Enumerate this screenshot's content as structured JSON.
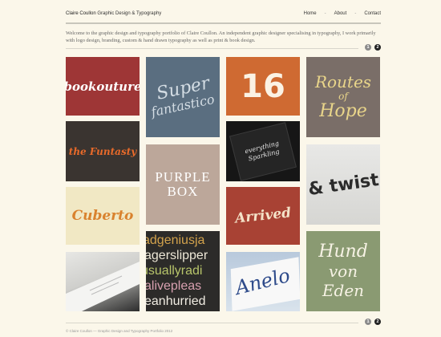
{
  "header": {
    "brand_name": "Claire Coullon",
    "brand_tagline": "Graphic Design & Typography",
    "nav": [
      "Home",
      "About",
      "Contact"
    ],
    "nav_separator": "-"
  },
  "intro": "Welcome to the graphic design and typography portfolio of Claire Coullon. An independent graphic designer specialising in typography, I work primarily with logo design, branding, custom & hand drawn typography as well as print & book design.",
  "pagination": {
    "pages": [
      "1",
      "2"
    ],
    "current": "2"
  },
  "tiles": {
    "bookouture": "bookouture",
    "super": "Super",
    "fantastico": "fantastico",
    "sixteen": "16",
    "routes": "Routes",
    "of": "of",
    "hope": "Hope",
    "the_funtasty": "the Funtasty",
    "invitation": "everything Sparkling",
    "purple": "PURPLE",
    "box": "BOX",
    "and_twist": "& twist",
    "cuberto": "Cuberto",
    "arrived": "Arrived",
    "lines": [
      "adgeniusja",
      "agerslipper",
      "usuallyradi",
      "alivepleas",
      "eanhurried"
    ],
    "anelo": "Anelo",
    "hund": "Hund",
    "von_eden": "von Eden"
  },
  "footer": "© Claire Coullon — Graphic Design and Typography Portfolio 2012",
  "colors": {
    "background": "#fbf7ea",
    "bookouture": "#9e3636",
    "super_fantastico": "#5a6e80",
    "sixteen": "#cf6a32",
    "routes_of_hope": "#7a6e68",
    "funtasty": "#3a3430",
    "purple_box": "#bca79a",
    "cuberto": "#f1e8c4",
    "arrived": "#a84234",
    "hund_von_eden": "#8a9a72"
  }
}
